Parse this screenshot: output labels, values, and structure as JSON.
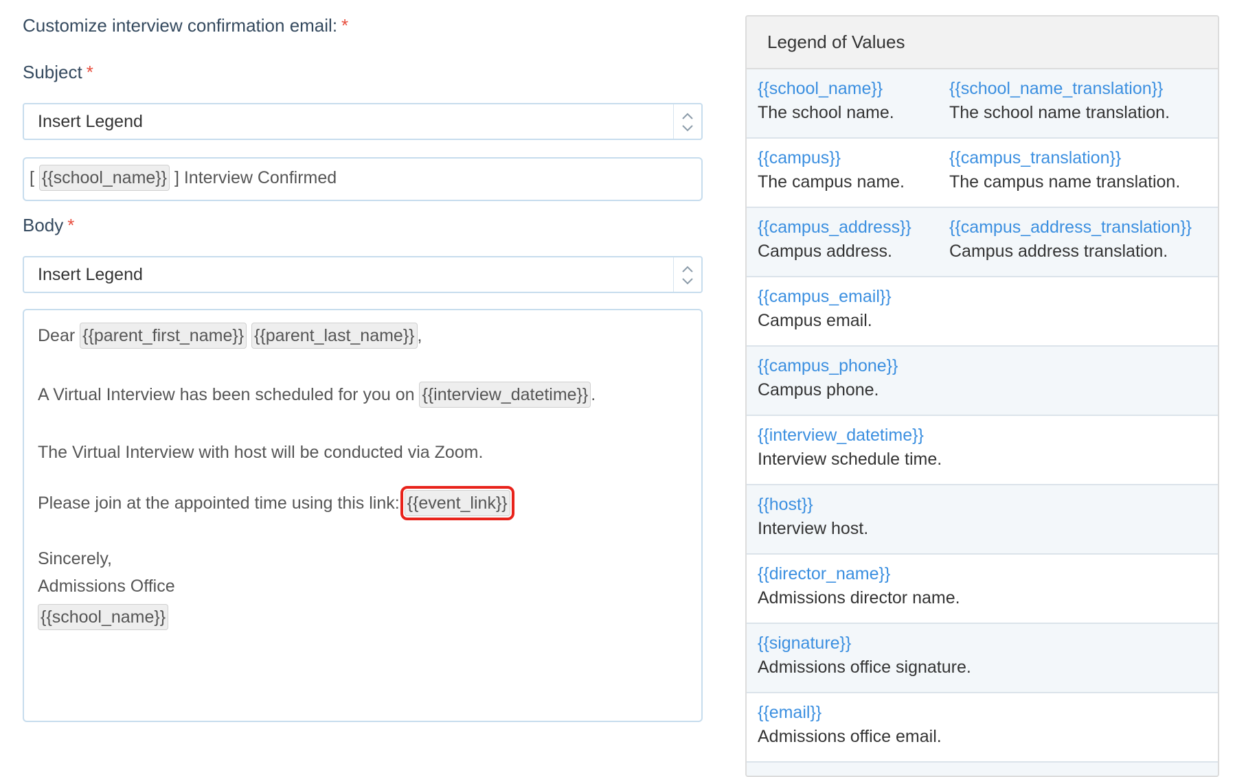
{
  "form": {
    "heading": "Customize interview confirmation email:",
    "required_mark": "*",
    "subject_label": "Subject",
    "subject_select": "Insert Legend",
    "subject_prefix": "[",
    "subject_tag": "{{school_name}}",
    "subject_suffix": "] Interview Confirmed",
    "body_label": "Body",
    "body_select": "Insert Legend",
    "body": {
      "dear": "Dear",
      "tag_first": "{{parent_first_name}}",
      "tag_last": "{{parent_last_name}}",
      "comma": ",",
      "line2": "A Virtual Interview has been scheduled for you on",
      "tag_datetime": "{{interview_datetime}}",
      "period": ".",
      "line3": "The Virtual Interview with host will be conducted via Zoom.",
      "line4": "Please join at the appointed time using this link:",
      "tag_event_link": "{{event_link}}",
      "sincerely": "Sincerely,",
      "office": "Admissions Office",
      "tag_school": "{{school_name}}"
    }
  },
  "legend": {
    "title": "Legend of Values",
    "rows": [
      {
        "k1": "{{school_name}}",
        "d1": "The school name.",
        "k2": "{{school_name_translation}}",
        "d2": "The school name translation."
      },
      {
        "k1": "{{campus}}",
        "d1": "The campus name.",
        "k2": "{{campus_translation}}",
        "d2": "The campus name translation."
      },
      {
        "k1": "{{campus_address}}",
        "d1": "Campus address.",
        "k2": "{{campus_address_translation}}",
        "d2": "Campus address translation."
      },
      {
        "k1": "{{campus_email}}",
        "d1": "Campus email."
      },
      {
        "k1": "{{campus_phone}}",
        "d1": "Campus phone."
      },
      {
        "k1": "{{interview_datetime}}",
        "d1": "Interview schedule time."
      },
      {
        "k1": "{{host}}",
        "d1": "Interview host."
      },
      {
        "k1": "{{director_name}}",
        "d1": "Admissions director name."
      },
      {
        "k1": "{{signature}}",
        "d1": "Admissions office signature."
      },
      {
        "k1": "{{email}}",
        "d1": "Admissions office email."
      }
    ]
  },
  "colors": {
    "link": "#3b8fe0",
    "required": "#e74c3c",
    "highlight": "#e8231b"
  }
}
